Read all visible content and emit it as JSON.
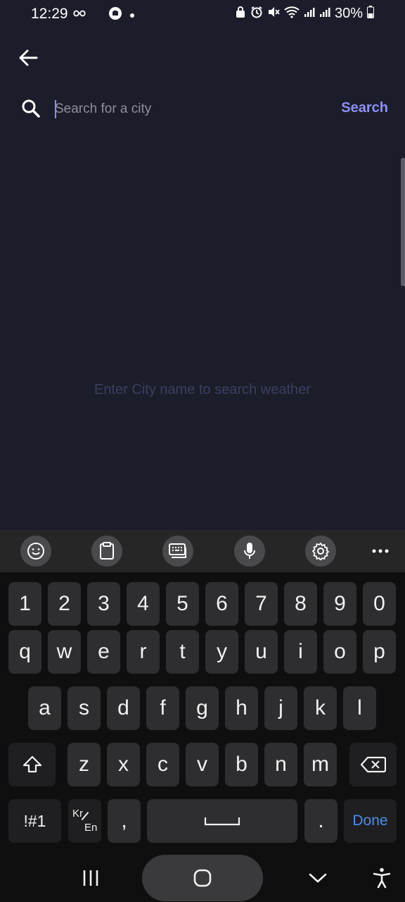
{
  "status_bar": {
    "time": "12:29",
    "battery": "30%"
  },
  "search": {
    "placeholder": "Search for a city",
    "value": "",
    "button_label": "Search"
  },
  "empty_state": {
    "message": "Enter City name to search weather"
  },
  "keyboard": {
    "toolbar": [
      "emoji-icon",
      "clipboard-icon",
      "keyboard-layout-icon",
      "microphone-icon",
      "settings-icon",
      "more-icon"
    ],
    "row_numbers": [
      "1",
      "2",
      "3",
      "4",
      "5",
      "6",
      "7",
      "8",
      "9",
      "0"
    ],
    "row_top": [
      "q",
      "w",
      "e",
      "r",
      "t",
      "y",
      "u",
      "i",
      "o",
      "p"
    ],
    "row_middle": [
      "a",
      "s",
      "d",
      "f",
      "g",
      "h",
      "j",
      "k",
      "l"
    ],
    "row_bottom": [
      "z",
      "x",
      "c",
      "v",
      "b",
      "n",
      "m"
    ],
    "symbols_label": "!#1",
    "lang_top": "Kr",
    "lang_bottom": "En",
    "comma": ",",
    "period": ".",
    "done_label": "Done"
  },
  "colors": {
    "background": "#1c1d2a",
    "accent": "#8d8ff7",
    "empty_text": "#3b3f5f",
    "done": "#4a8fe8"
  }
}
